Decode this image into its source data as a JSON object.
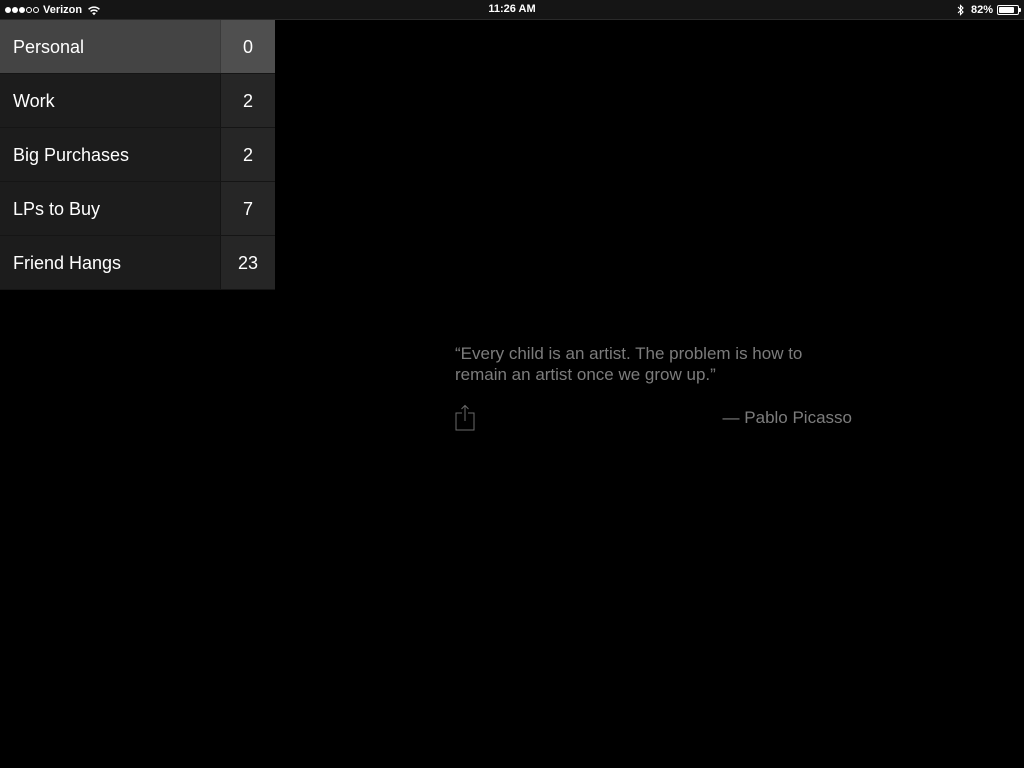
{
  "status_bar": {
    "signal_filled": 3,
    "signal_total": 5,
    "carrier": "Verizon",
    "time": "11:26 AM",
    "battery_percent": "82%",
    "battery_level": 0.82,
    "icons": [
      "wifi-icon",
      "bluetooth-icon",
      "battery-icon"
    ]
  },
  "lists": [
    {
      "label": "Personal",
      "count": "0",
      "selected": true
    },
    {
      "label": "Work",
      "count": "2",
      "selected": false
    },
    {
      "label": "Big Purchases",
      "count": "2",
      "selected": false
    },
    {
      "label": "LPs to Buy",
      "count": "7",
      "selected": false
    },
    {
      "label": "Friend Hangs",
      "count": "23",
      "selected": false
    }
  ],
  "quote": {
    "text": "“Every child is an artist. The problem is how to remain an artist once we grow up.”",
    "author": "— Pablo Picasso",
    "share_icon": "share-icon"
  },
  "colors": {
    "background": "#000000",
    "selected_row": "#444444",
    "row": "#1c1c1c",
    "quote_text": "#7c7c7c"
  }
}
